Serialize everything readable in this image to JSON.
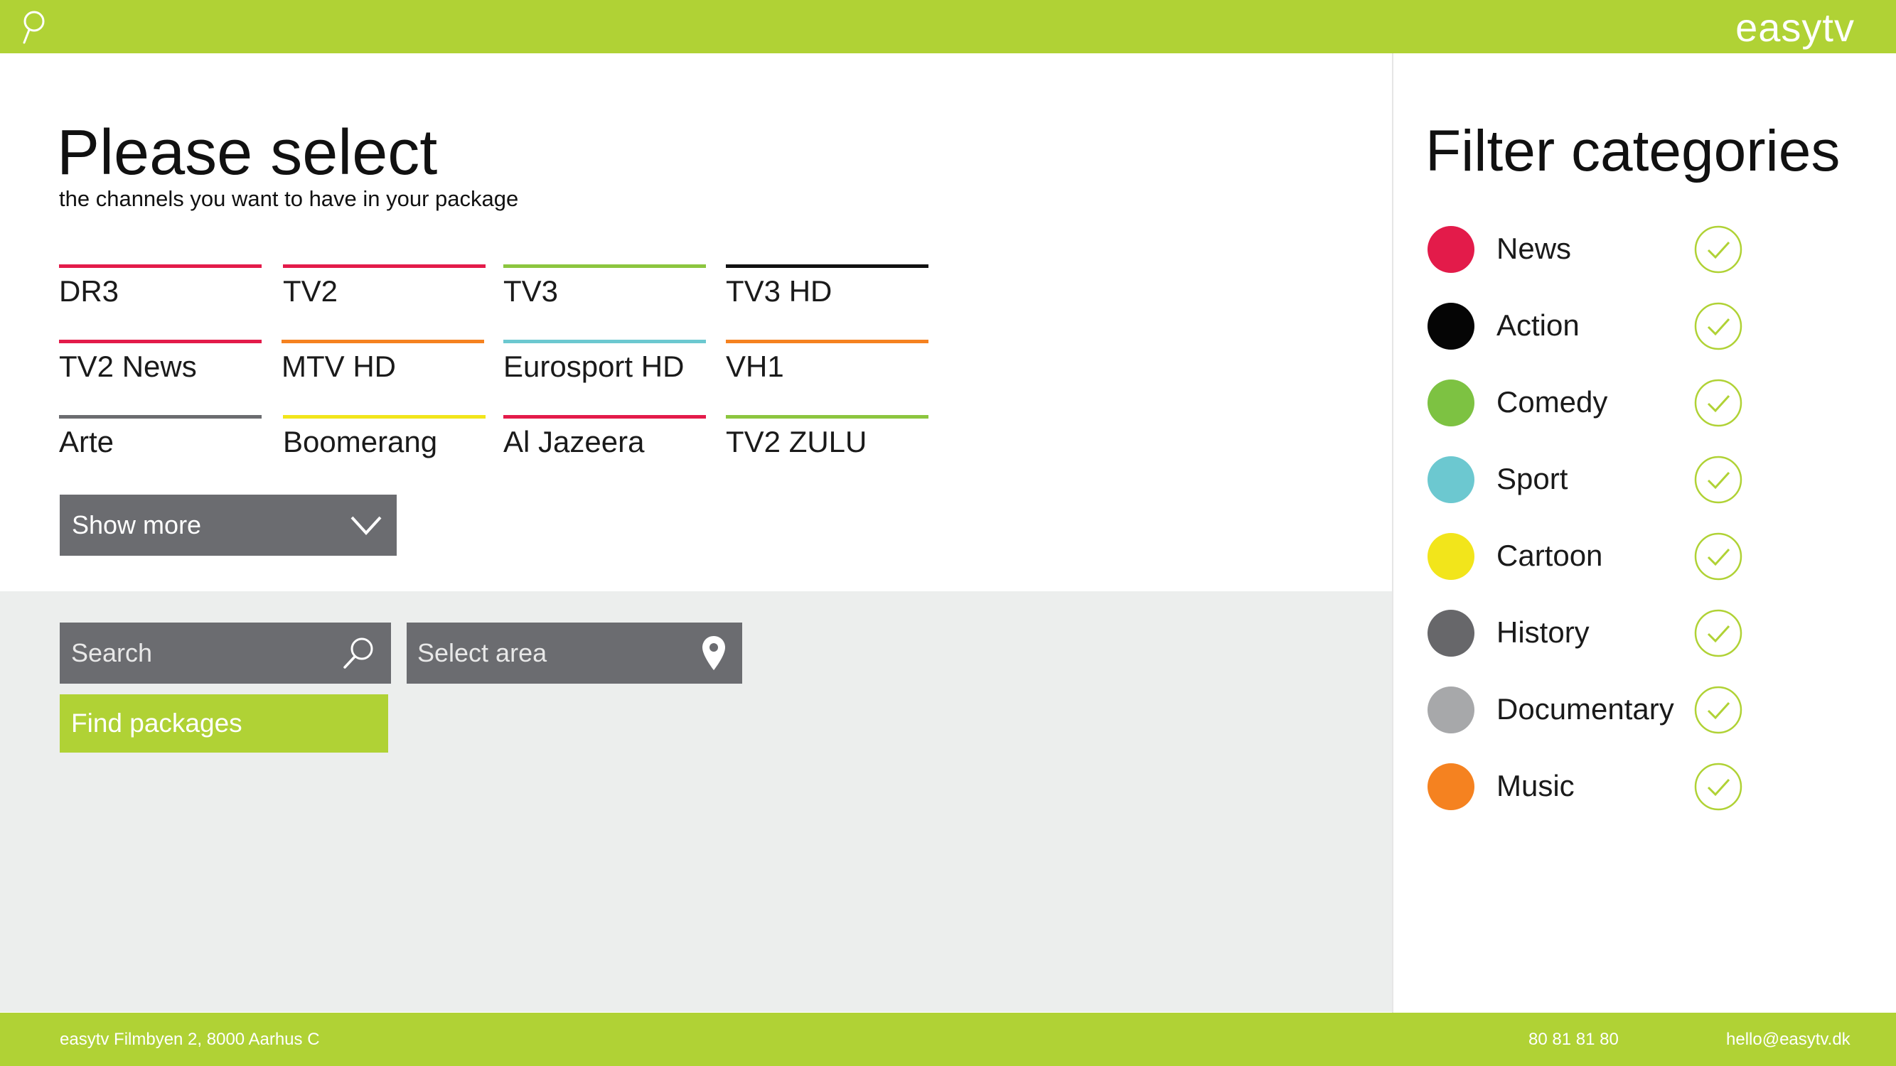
{
  "header": {
    "logo": "easytv",
    "search_icon": "search-icon"
  },
  "main": {
    "title": "Please select",
    "subtitle": "the channels you want to have in your package",
    "channels": [
      {
        "name": "DR3",
        "color": "#e31b4a"
      },
      {
        "name": "TV2",
        "color": "#e31b4a"
      },
      {
        "name": "TV3",
        "color": "#8cc63f"
      },
      {
        "name": "TV3 HD",
        "color": "#111111"
      },
      {
        "name": "TV2 News",
        "color": "#e31b4a"
      },
      {
        "name": "MTV HD",
        "color": "#f58220"
      },
      {
        "name": "Eurosport HD",
        "color": "#6cc8d0"
      },
      {
        "name": "VH1",
        "color": "#f58220"
      },
      {
        "name": "Arte",
        "color": "#6b6c70"
      },
      {
        "name": "Boomerang",
        "color": "#f2e51b"
      },
      {
        "name": "Al Jazeera",
        "color": "#e31b4a"
      },
      {
        "name": "TV2 ZULU",
        "color": "#8cc63f"
      }
    ],
    "show_more_label": "Show more",
    "search_placeholder": "Search",
    "area_placeholder": "Select area",
    "find_label": "Find packages"
  },
  "sidebar": {
    "title": "Filter categories",
    "categories": [
      {
        "label": "News",
        "color": "#e31b4a",
        "checked": true
      },
      {
        "label": "Action",
        "color": "#050505",
        "checked": true
      },
      {
        "label": "Comedy",
        "color": "#7dc242",
        "checked": true
      },
      {
        "label": "Sport",
        "color": "#6cc8d0",
        "checked": true
      },
      {
        "label": "Cartoon",
        "color": "#f2e51b",
        "checked": true
      },
      {
        "label": "History",
        "color": "#67676a",
        "checked": true
      },
      {
        "label": "Documentary",
        "color": "#a7a8aa",
        "checked": true
      },
      {
        "label": "Music",
        "color": "#f58220",
        "checked": true
      }
    ]
  },
  "footer": {
    "address": "easytv  Filmbyen 2, 8000 Aarhus C",
    "phone": "80 81 81 80",
    "email": "hello@easytv.dk"
  },
  "colors": {
    "accent": "#b0d235",
    "control_gray": "#6b6c70",
    "panel_gray": "#eceeed"
  }
}
